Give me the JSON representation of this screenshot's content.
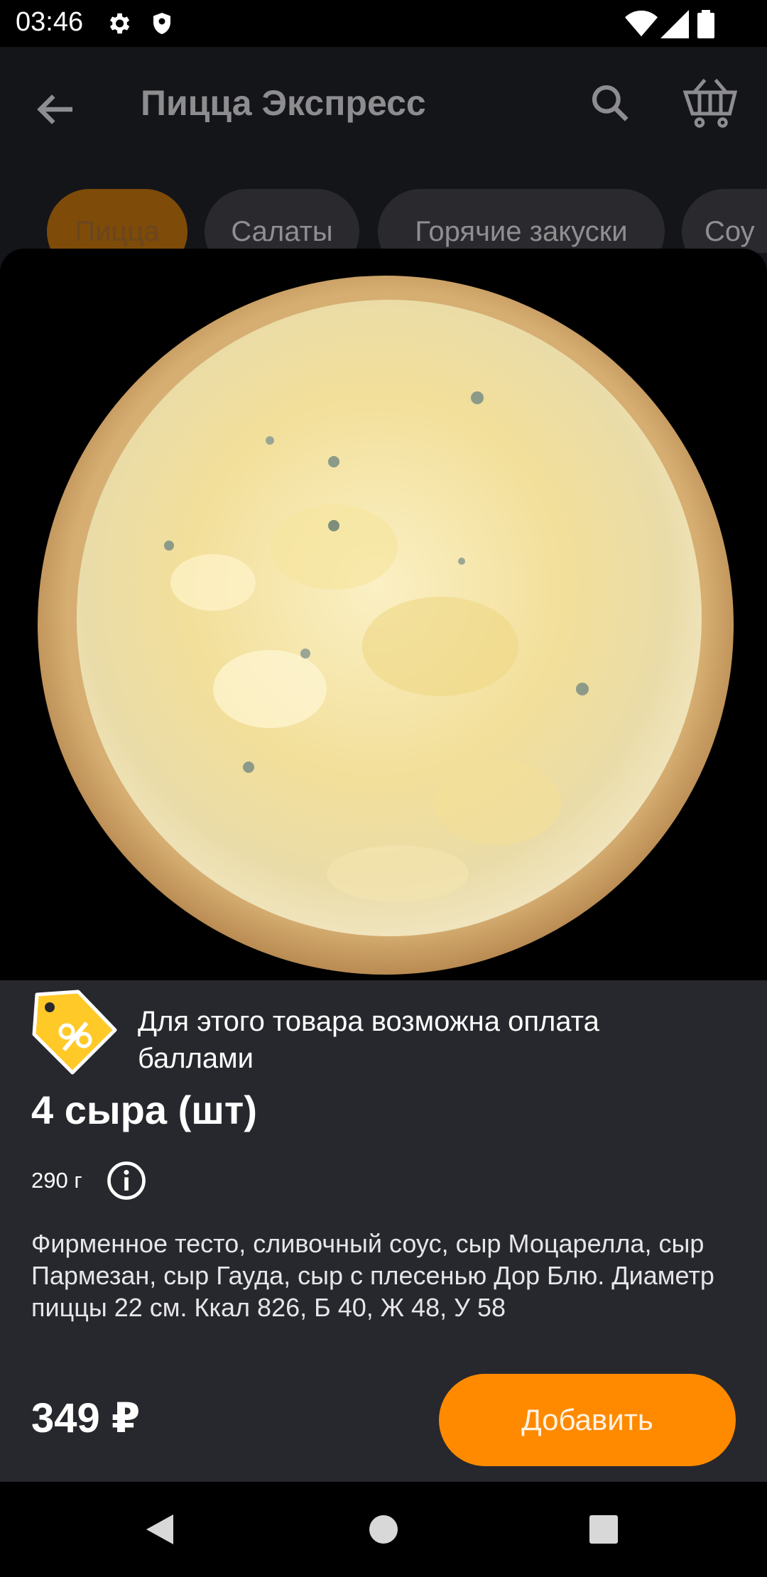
{
  "status_bar": {
    "time": "03:46",
    "icons": [
      "gear-icon",
      "shield-icon",
      "wifi-icon",
      "signal-icon",
      "battery-icon"
    ]
  },
  "app_bar": {
    "title": "Пицца Экспресс",
    "icons": [
      "back-arrow-icon",
      "search-icon",
      "cart-icon"
    ]
  },
  "categories": [
    "Пицца",
    "Салаты",
    "Горячие закуски",
    "Соу"
  ],
  "product": {
    "points_notice": "Для этого товара возможна оплата баллами",
    "name": "4 сыра (шт)",
    "weight": "290 г",
    "description": "Фирменное тесто, сливочный соус, сыр Моцарелла, сыр Пармезан, сыр Гауда, сыр с плесенью Дор Блю. Диаметр пиццы 22 см. Ккал 826, Б 40, Ж 48, У 58",
    "price": "349 ₽",
    "add_label": "Добавить"
  },
  "colors": {
    "accent": "#ff8a00",
    "sheet_bg": "#27282d",
    "badge_yellow": "#ffc928"
  }
}
